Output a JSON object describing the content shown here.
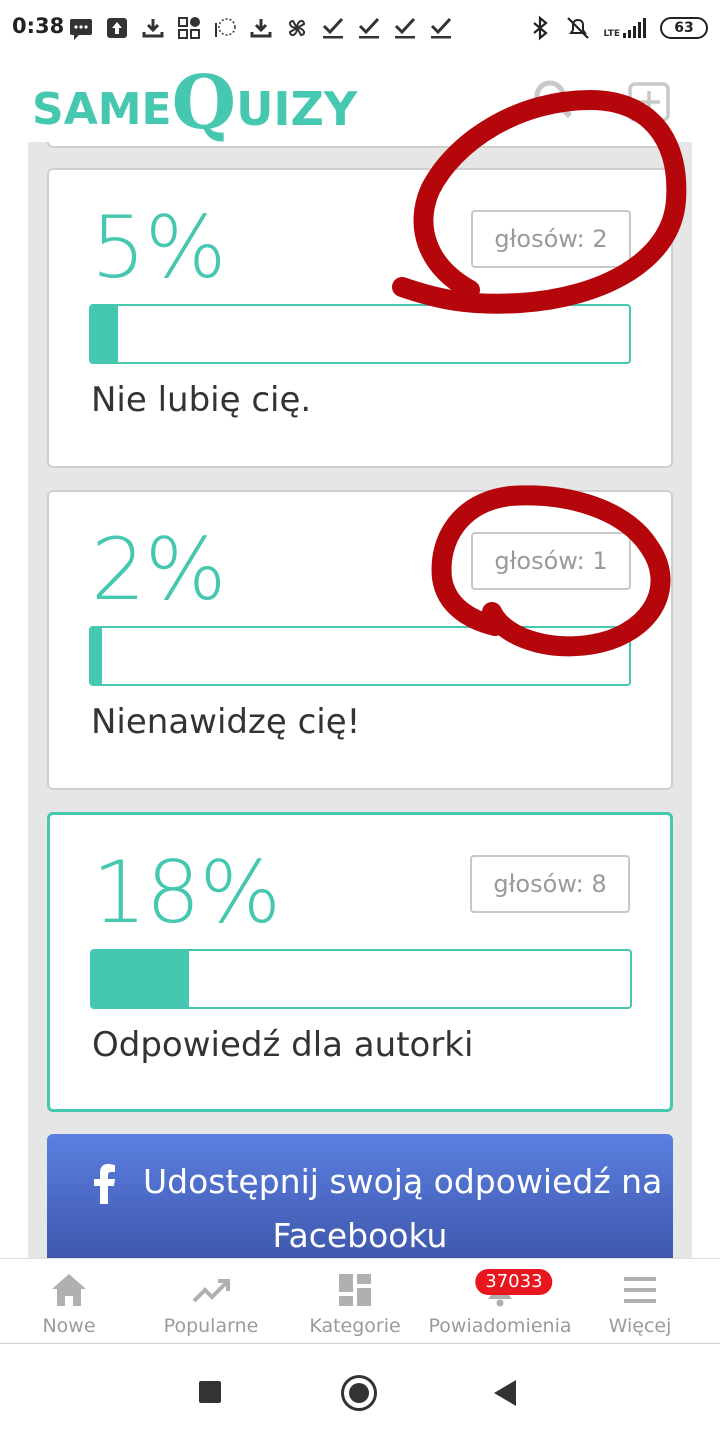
{
  "status_bar": {
    "time": "0:38",
    "network": "LTE",
    "battery": "63",
    "icons": [
      "message-icon",
      "upload-icon",
      "download-icon",
      "qr-icon",
      "download-icon",
      "pinwheel-icon",
      "check-icon",
      "check-icon",
      "check-icon",
      "check-icon",
      "bluetooth-icon",
      "mute-icon",
      "signal-icon",
      "battery-icon"
    ]
  },
  "header": {
    "logo_same": "SAME",
    "logo_q": "Q",
    "logo_uizy": "UIZY",
    "search_icon": "search-icon",
    "add_icon": "add-icon"
  },
  "results": [
    {
      "percent": "5%",
      "percent_value": 5,
      "votes": "głosów: 2",
      "answer": "Nie lubię cię.",
      "selected": false,
      "circled": true
    },
    {
      "percent": "2%",
      "percent_value": 2,
      "votes": "głosów: 1",
      "answer": "Nienawidzę cię!",
      "selected": false,
      "circled": true
    },
    {
      "percent": "18%",
      "percent_value": 18,
      "votes": "głosów: 8",
      "answer": "Odpowiedź dla autorki",
      "selected": true,
      "circled": false
    }
  ],
  "share": {
    "line1": "Udostępnij swoją odpowiedź na",
    "line2": "Facebooku",
    "icon": "facebook-icon"
  },
  "bottom_nav": {
    "items": [
      {
        "label": "Nowe",
        "icon": "home-icon"
      },
      {
        "label": "Popularne",
        "icon": "trending-icon"
      },
      {
        "label": "Kategorie",
        "icon": "categories-icon"
      },
      {
        "label": "Powiadomienia",
        "icon": "bell-icon",
        "badge": "37033"
      },
      {
        "label": "Więcej",
        "icon": "menu-icon"
      }
    ]
  },
  "colors": {
    "accent": "#45c7b0",
    "annotation": "#b5060b",
    "facebook_top": "#5b7fe0",
    "facebook_bottom": "#3b53a7",
    "badge": "#e8161e"
  }
}
